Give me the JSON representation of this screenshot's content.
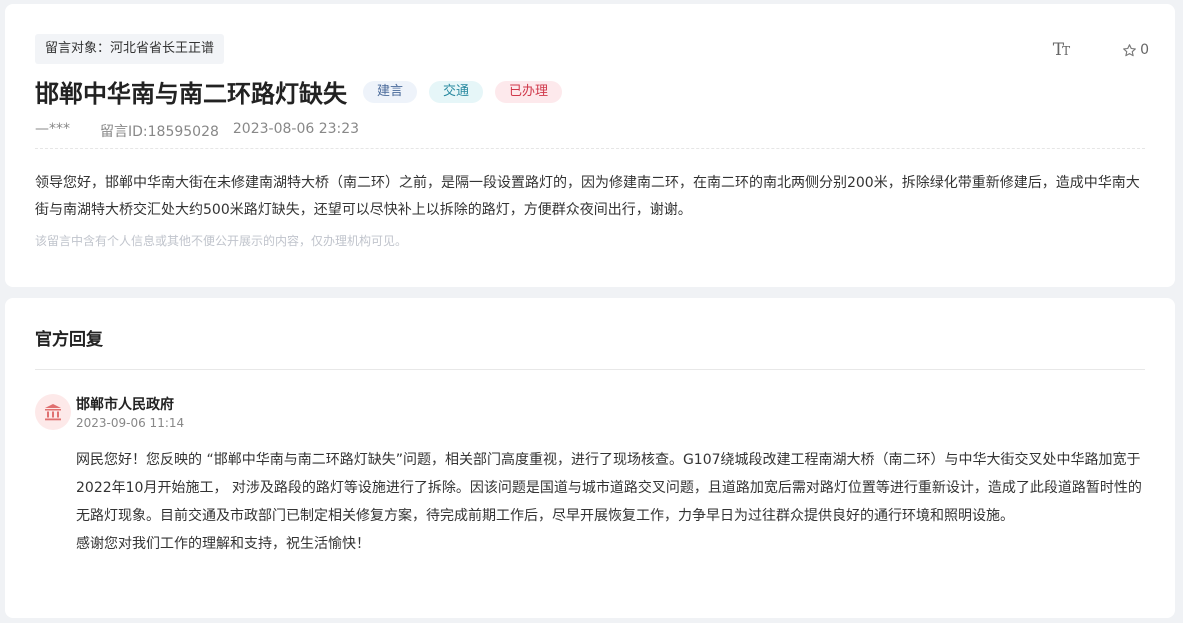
{
  "message": {
    "target": "留言对象：河北省省长王正谱",
    "title": "邯郸中华南与南二环路灯缺失",
    "tags": [
      {
        "label": "建言",
        "bg": "#eef3fa",
        "color": "#4a6a9a"
      },
      {
        "label": "交通",
        "bg": "#e6f6f8",
        "color": "#2a8aa0"
      },
      {
        "label": "已办理",
        "bg": "#fde9ec",
        "color": "#d0394b"
      }
    ],
    "favorite_count": "0",
    "font_size_icon": "font-size-icon",
    "author": "—***",
    "message_id": "留言ID:18595028",
    "datetime": "2023-08-06 23:23",
    "body": "领导您好，邯郸中华南大街在未修建南湖特大桥（南二环）之前，是隔一段设置路灯的，因为修建南二环，在南二环的南北两侧分别200米，拆除绿化带重新修建后，造成中华南大街与南湖特大桥交汇处大约500米路灯缺失，还望可以尽快补上以拆除的路灯，方便群众夜间出行，谢谢。",
    "privacy_notice": "该留言中含有个人信息或其他不便公开展示的内容，仅办理机构可见。"
  },
  "reply": {
    "heading": "官方回复",
    "organization": "邯郸市人民政府",
    "datetime": "2023-09-06 11:14",
    "paragraph1": "网民您好！您反映的 “邯郸中华南与南二环路灯缺失”问题，相关部门高度重视，进行了现场核查。G107绕城段改建工程南湖大桥（南二环）与中华大街交叉处中华路加宽于2022年10月开始施工， 对涉及路段的路灯等设施进行了拆除。因该问题是国道与城市道路交叉问题，且道路加宽后需对路灯位置等进行重新设计，造成了此段道路暂时性的无路灯现象。目前交通及市政部门已制定相关修复方案，待完成前期工作后，尽早开展恢复工作，力争早日为过往群众提供良好的通行环境和照明设施。",
    "paragraph2": "感谢您对我们工作的理解和支持，祝生活愉快！"
  },
  "colors": {
    "page_bg": "#f0f2f5",
    "avatar_bg": "#fde9e9",
    "avatar_icon": "#e07070"
  },
  "icons": {
    "favorite": "star-icon",
    "avatar": "government-building-icon"
  }
}
